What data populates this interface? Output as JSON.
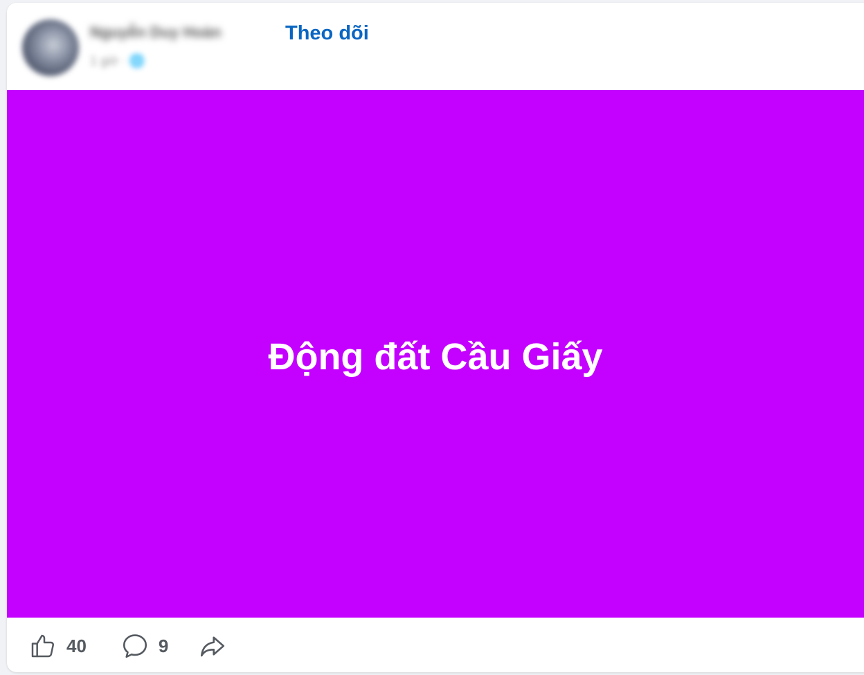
{
  "header": {
    "author_name": "Nguyễn Duy Hoàn",
    "post_meta": "1 giờ · 🌐",
    "follow_label": "Theo dõi"
  },
  "media": {
    "text": "Động đất Cầu Giấy",
    "background_color": "#c400ff"
  },
  "actions": {
    "like_count": "40",
    "comment_count": "9",
    "like_icon": "thumbs-up-icon",
    "comment_icon": "comment-icon",
    "share_icon": "share-icon"
  },
  "colors": {
    "accent": "#0a66c2",
    "icon": "#555a60"
  }
}
